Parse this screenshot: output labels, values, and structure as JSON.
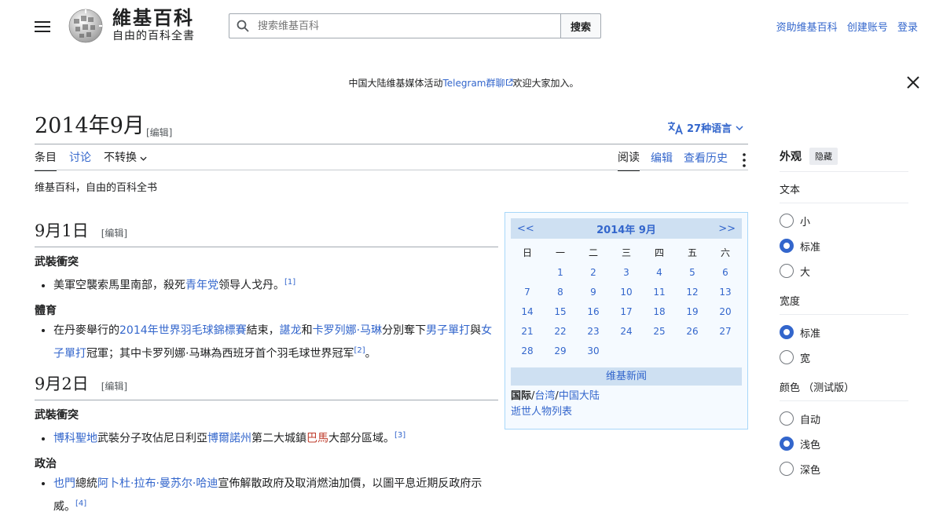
{
  "header": {
    "wordmark_title": "維基百科",
    "wordmark_tagline": "自由的百科全書",
    "search_placeholder": "搜索维基百科",
    "search_button": "搜索",
    "user_links": [
      "资助维基百科",
      "创建账号",
      "登录"
    ]
  },
  "banner": {
    "prefix": "中国大陆维基媒体活动",
    "link": "Telegram群聊",
    "suffix": "欢迎大家加入。"
  },
  "page": {
    "title": "2014年9月",
    "title_edit": "[编辑]",
    "lang_label": "27种语言",
    "tabs_left": [
      "条目",
      "讨论",
      "不转换"
    ],
    "tabs_right": [
      "阅读",
      "编辑",
      "查看历史"
    ],
    "sitesub": "维基百科，自由的百科全书"
  },
  "sections": [
    {
      "heading": "9月1日",
      "edit": "[编辑]",
      "subsections": [
        {
          "title": "武裝衝突",
          "items": [
            {
              "parts": [
                {
                  "text": "美軍空襲索馬里南部，殺死"
                },
                {
                  "text": "青年党",
                  "link": true
                },
                {
                  "text": "领导人戈丹。"
                },
                {
                  "text": "[1]",
                  "ref": true
                }
              ]
            }
          ]
        },
        {
          "title": "體育",
          "items": [
            {
              "parts": [
                {
                  "text": "在丹麥舉行的"
                },
                {
                  "text": "2014年世界羽毛球錦標賽",
                  "link": true
                },
                {
                  "text": "結束，"
                },
                {
                  "text": "諶龙",
                  "link": true
                },
                {
                  "text": "和"
                },
                {
                  "text": "卡罗列娜·马琳",
                  "link": true
                },
                {
                  "text": "分別奪下"
                },
                {
                  "text": "男子單打",
                  "link": true
                },
                {
                  "text": "與"
                },
                {
                  "text": "女子單打",
                  "link": true
                },
                {
                  "text": "冠軍；其中卡罗列娜·马琳為西班牙首个羽毛球世界冠军"
                },
                {
                  "text": "[2]",
                  "ref": true
                },
                {
                  "text": "。"
                }
              ]
            }
          ]
        }
      ]
    },
    {
      "heading": "9月2日",
      "edit": "[编辑]",
      "subsections": [
        {
          "title": "武裝衝突",
          "items": [
            {
              "parts": [
                {
                  "text": "博科聖地",
                  "link": true
                },
                {
                  "text": "武裝分子攻佔尼日利亞"
                },
                {
                  "text": "博爾諾州",
                  "link": true
                },
                {
                  "text": "第二大城鎮"
                },
                {
                  "text": "巴馬",
                  "red": true
                },
                {
                  "text": "大部分區域。"
                },
                {
                  "text": "[3]",
                  "ref": true
                }
              ]
            }
          ]
        },
        {
          "title": "政治",
          "items": [
            {
              "parts": [
                {
                  "text": "也門",
                  "link": true
                },
                {
                  "text": "總統"
                },
                {
                  "text": "阿卜杜·拉布·曼苏尔·哈迪",
                  "link": true
                },
                {
                  "text": "宣佈解散政府及取消燃油加價，以圖平息近期反政府示威。"
                },
                {
                  "text": "[4]",
                  "ref": true
                }
              ]
            }
          ]
        }
      ]
    }
  ],
  "calendar": {
    "prev": "<<",
    "next": ">>",
    "month": "2014年 9月",
    "weekdays": [
      "日",
      "一",
      "二",
      "三",
      "四",
      "五",
      "六"
    ],
    "leading_blanks": 1,
    "days": [
      "1",
      "2",
      "3",
      "4",
      "5",
      "6",
      "7",
      "8",
      "9",
      "10",
      "11",
      "12",
      "13",
      "14",
      "15",
      "16",
      "17",
      "18",
      "19",
      "20",
      "21",
      "22",
      "23",
      "24",
      "25",
      "26",
      "27",
      "28",
      "29",
      "30"
    ],
    "news_title": "维基新闻",
    "foot_label": "国际",
    "foot_links": [
      "台湾",
      "中国大陆"
    ],
    "foot_sep": "/",
    "foot_line2": "逝世人物列表"
  },
  "appearance": {
    "title": "外观",
    "hide": "隐藏",
    "groups": [
      {
        "label": "文本",
        "options": [
          "小",
          "标准",
          "大"
        ],
        "selected": 1
      },
      {
        "label": "宽度",
        "options": [
          "标准",
          "宽"
        ],
        "selected": 0
      },
      {
        "label": "颜色 （测试版）",
        "options": [
          "自动",
          "浅色",
          "深色"
        ],
        "selected": 1
      }
    ]
  },
  "colors": {
    "link": "#3366cc",
    "redlink": "#bf3c2c",
    "calendar_header": "#cee0f2",
    "calendar_bg": "#f5faff"
  },
  "icons": [
    "menu-icon",
    "wikipedia-globe-logo",
    "search-icon",
    "external-link-icon",
    "close-icon",
    "translate-icon",
    "chevron-down-icon",
    "more-vertical-icon"
  ]
}
